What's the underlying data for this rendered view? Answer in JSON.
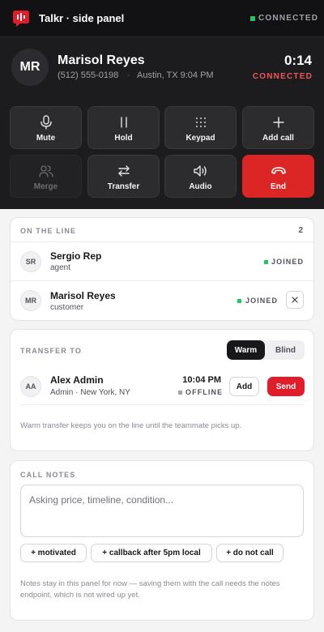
{
  "app": {
    "title": "Talkr · side panel",
    "status": "CONNECTED",
    "accent": "#dc2626"
  },
  "caller": {
    "initials": "MR",
    "name": "Marisol Reyes",
    "phone": "(512) 555-0198",
    "separator": "·",
    "location": "Austin, TX 9:04 PM",
    "timer": "0:14",
    "status": "CONNECTED"
  },
  "controls": [
    {
      "label": "Mute",
      "icon": "microphone-icon"
    },
    {
      "label": "Hold",
      "icon": "pause-icon"
    },
    {
      "label": "Keypad",
      "icon": "keypad-icon"
    },
    {
      "label": "Add call",
      "icon": "plus-icon"
    },
    {
      "label": "Merge",
      "icon": "users-icon",
      "disabled": true
    },
    {
      "label": "Transfer",
      "icon": "transfer-icon"
    },
    {
      "label": "Audio",
      "icon": "speaker-icon"
    },
    {
      "label": "End",
      "icon": "hangup-icon"
    }
  ],
  "on_the_line": {
    "label": "ON THE LINE",
    "count": "2",
    "participants": [
      {
        "initials": "SR",
        "name": "Sergio Rep",
        "role": "agent",
        "status": "JOINED"
      },
      {
        "initials": "MR",
        "name": "Marisol Reyes",
        "role": "customer",
        "status": "JOINED"
      }
    ]
  },
  "transfer": {
    "label": "TRANSFER TO",
    "mode_warm": "Warm",
    "mode_blind": "Blind",
    "selected_mode": "Warm",
    "target": {
      "initials": "AA",
      "name": "Alex Admin",
      "detail": "Admin · New York, NY",
      "time": "10:04 PM",
      "status": "OFFLINE"
    },
    "add_label": "Add",
    "send_label": "Send",
    "hint": "Warm transfer keeps you on the line until the teammate picks up."
  },
  "notes": {
    "label": "CALL NOTES",
    "placeholder": "Asking price, timeline, condition...",
    "value": "",
    "chips": [
      "+ motivated",
      "+ callback after 5pm local",
      "+ do not call"
    ],
    "footer": "Notes stay in this panel for now — saving them with the call needs the notes endpoint, which is not wired up yet."
  }
}
